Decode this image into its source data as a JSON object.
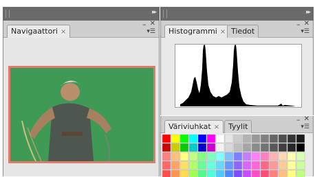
{
  "left_panel": {
    "tab_label": "Navigaattori",
    "close_glyph": "×"
  },
  "histogram_panel": {
    "tabs": [
      {
        "label": "Histogrammi",
        "close_glyph": "×",
        "active": true
      },
      {
        "label": "Tiedot",
        "active": false
      }
    ]
  },
  "swatches_panel": {
    "tabs": [
      {
        "label": "Väriviuhkat",
        "close_glyph": "×",
        "active": true
      },
      {
        "label": "Tyylit",
        "active": false
      }
    ],
    "swatch_rows": [
      [
        "#ff0000",
        "#ffff00",
        "#00ff00",
        "#00ffff",
        "#0000ff",
        "#ff00ff",
        "#ffffff",
        "#e6e6e6",
        "#cccccc",
        "#b3b3b3",
        "#999999",
        "#808080",
        "#666666",
        "#4d4d4d",
        "#333333",
        "#1a1a1a"
      ],
      [
        "#cc0000",
        "#cccc00",
        "#00cc00",
        "#00cccc",
        "#0000cc",
        "#cc00cc",
        "#f2f2f2",
        "#d9d9d9",
        "#bfbfbf",
        "#a6a6a6",
        "#8c8c8c",
        "#737373",
        "#595959",
        "#404040",
        "#262626",
        "#000000"
      ],
      [
        "#ff8080",
        "#ffc080",
        "#ffff80",
        "#c0ff80",
        "#80ff80",
        "#80ffc0",
        "#80ffff",
        "#80c0ff",
        "#8080ff",
        "#c080ff",
        "#ff80ff",
        "#ff80c0",
        "#ffb3b3",
        "#ffd9b3",
        "#ffffb3",
        "#d9ffb3"
      ],
      [
        "#ff6666",
        "#ffa366",
        "#ffe066",
        "#b3ff66",
        "#66ff99",
        "#66ffe0",
        "#66d9ff",
        "#6699ff",
        "#8c66ff",
        "#d966ff",
        "#ff66d9",
        "#ff668c",
        "#ff9999",
        "#ffcc99",
        "#ffff99",
        "#ccff99"
      ],
      [
        "#ff4d4d",
        "#ff944d",
        "#ffdb4d",
        "#a3ff4d",
        "#4dff88",
        "#4dffdb",
        "#4dc9ff",
        "#4d88ff",
        "#7a4dff",
        "#c94dff",
        "#ff4dc9",
        "#ff4d7a",
        "#ff8080",
        "#ffbf80",
        "#ffff80",
        "#bfff80"
      ]
    ]
  },
  "chrome_colors": {
    "titlebar": "#6a6a6a",
    "frame_border": "#e07b6a",
    "image_green": "#3f9a56"
  }
}
